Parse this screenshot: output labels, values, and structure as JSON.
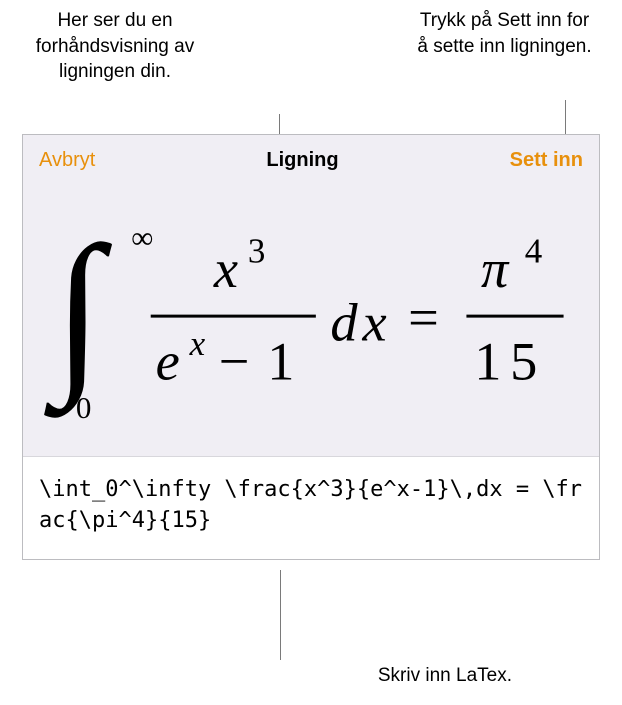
{
  "callouts": {
    "preview": "Her ser du en forhåndsvisning av ligningen din.",
    "insert": "Trykk på Sett inn for å sette inn ligningen.",
    "latex": "Skriv inn LaTex."
  },
  "header": {
    "cancel": "Avbryt",
    "title": "Ligning",
    "insert": "Sett inn"
  },
  "equation": {
    "latex_source": "\\int_0^\\infty \\frac{x^3}{e^x-1}\\,dx = \\frac{\\pi^4}{15}"
  }
}
